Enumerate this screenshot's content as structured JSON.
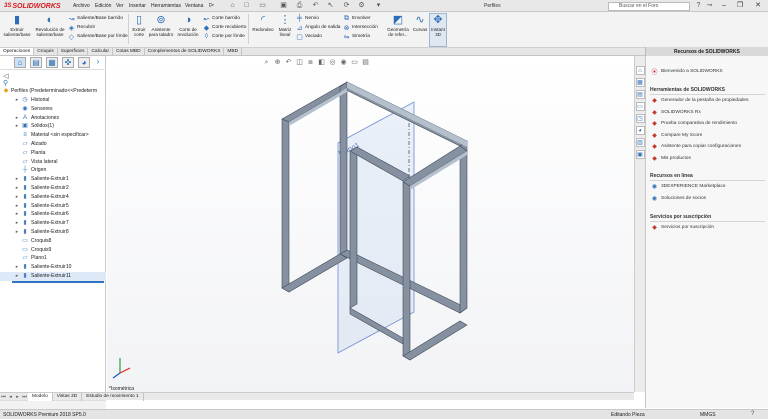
{
  "app": {
    "brand": "SOLIDWORKS",
    "brand_prefix": "3S"
  },
  "menu": [
    "Archivo",
    "Edición",
    "Ver",
    "Insertar",
    "Herramientas",
    "Ventana"
  ],
  "document_title": "Perfiles",
  "search": {
    "placeholder": "Buscar en el Foro"
  },
  "ribbon": {
    "extrude_boss": "Extruir saliente/base",
    "revolve_boss": "Revolución de saliente/base",
    "swept_boss": "Saliente/Base barrido",
    "lofted_boss": "Recubrir",
    "boundary_boss": "Saliente/Base por límite",
    "extrude_cut": "Extruir corte",
    "hole_wizard": "Asistente para taladro",
    "revolve_cut": "Corte de revolución",
    "swept_cut": "Corte barrido",
    "lofted_cut": "Corte recubierto",
    "boundary_cut": "Corte por límite",
    "fillet": "Redondeo",
    "linear_pattern": "Matriz lineal",
    "rib": "Nervio",
    "draft": "Ángulo de salida",
    "shell": "Vaciado",
    "wrap": "Envolver",
    "intersect": "Intersección",
    "mirror": "Simetría",
    "reference_geometry": "Geometría de refer...",
    "curves": "Curvas",
    "instant3d": "Instant 3D"
  },
  "command_tabs": [
    "Operaciones",
    "Croquis",
    "Superficies",
    "Calcular",
    "Cotas MBD",
    "Complementos de SOLIDWORKS",
    "MBD"
  ],
  "feature_tree": {
    "root": "Perfiles  (Predeterminado<<Predeterm",
    "items": [
      {
        "label": "Historial",
        "icon": "history-icon",
        "expandable": true
      },
      {
        "label": "Sensores",
        "icon": "sensor-icon",
        "expandable": false
      },
      {
        "label": "Anotaciones",
        "icon": "annotation-icon",
        "expandable": true
      },
      {
        "label": "Sólidos(1)",
        "icon": "solid-bodies-icon",
        "expandable": true
      },
      {
        "label": "Material <sin especificar>",
        "icon": "material-icon",
        "expandable": false
      },
      {
        "label": "Alzado",
        "icon": "plane-icon",
        "expandable": false
      },
      {
        "label": "Planta",
        "icon": "plane-icon",
        "expandable": false
      },
      {
        "label": "Vista lateral",
        "icon": "plane-icon",
        "expandable": false
      },
      {
        "label": "Origen",
        "icon": "origin-icon",
        "expandable": false
      },
      {
        "label": "Saliente-Extruir1",
        "icon": "extrude-icon",
        "expandable": true
      },
      {
        "label": "Saliente-Extruir2",
        "icon": "extrude-icon",
        "expandable": true
      },
      {
        "label": "Saliente-Extruir4",
        "icon": "extrude-icon",
        "expandable": true
      },
      {
        "label": "Saliente-Extruir5",
        "icon": "extrude-icon",
        "expandable": true
      },
      {
        "label": "Saliente-Extruir6",
        "icon": "extrude-icon",
        "expandable": true
      },
      {
        "label": "Saliente-Extruir7",
        "icon": "extrude-icon",
        "expandable": true
      },
      {
        "label": "Saliente-Extruir8",
        "icon": "extrude-icon",
        "expandable": true
      },
      {
        "label": "Croquis8",
        "icon": "sketch-icon",
        "expandable": false
      },
      {
        "label": "Croquis9",
        "icon": "sketch-icon",
        "expandable": false
      },
      {
        "label": "Plano1",
        "icon": "plane-icon",
        "expandable": false
      },
      {
        "label": "Saliente-Extruir10",
        "icon": "extrude-icon",
        "expandable": true
      },
      {
        "label": "Saliente-Extruir11",
        "icon": "extrude-icon",
        "expandable": true
      }
    ]
  },
  "graphics": {
    "plane_label": "Plano1",
    "view_label": "*Isométrica"
  },
  "task_pane": {
    "title": "Recursos de SOLIDWORKS",
    "welcome": "Bienvenido a SOLIDWORKS",
    "tools_heading": "Herramientas de SOLIDWORKS",
    "tools": [
      "Generador de la pestaña de propiedades",
      "SOLIDWORKS Rx",
      "Prueba comparativa de rendimiento",
      "Compare My Score",
      "Asistente para copiar configuraciones",
      "Mis productos"
    ],
    "online_heading": "Recursos en línea",
    "online": [
      "3DEXPERIENCE Marketplace",
      "Soluciones de socios"
    ],
    "subscription_heading": "Servicios por suscripción",
    "subscription": [
      "Servicios por suscripción"
    ]
  },
  "bottom_tabs": [
    "Modelo",
    "Vistas 3D",
    "Estudio de movimiento 1"
  ],
  "status": {
    "product": "SOLIDWORKS Premium 2018 SP5.0",
    "mode": "Editando Pieza",
    "units": "MMGS"
  },
  "colors": {
    "accent": "#2d6fb6",
    "frame": "#6b7a8c",
    "brand_red": "#d71920"
  }
}
